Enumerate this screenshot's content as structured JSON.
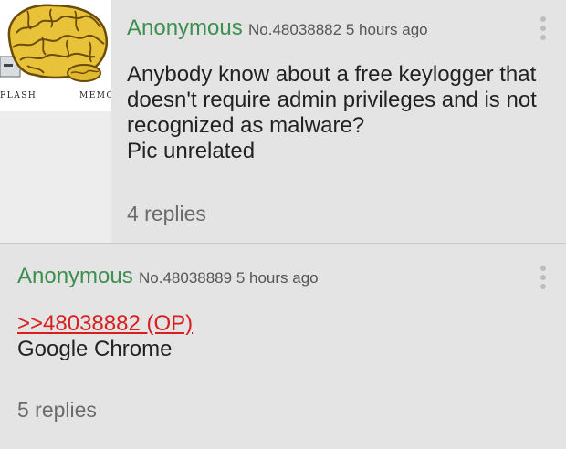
{
  "posts": [
    {
      "name": "Anonymous",
      "number": "No.48038882",
      "time": "5 hours ago",
      "body": [
        "Anybody know about a free keylogger that",
        "doesn't require admin privileges and is not",
        "recognized as malware?",
        "Pic unrelated"
      ],
      "replies": "4 replies",
      "image_label_left": "FLASH",
      "image_label_right": "MEMORY"
    },
    {
      "name": "Anonymous",
      "number": "No.48038889",
      "time": "5 hours ago",
      "quote": ">>48038882 (OP)",
      "body": [
        "Google Chrome"
      ],
      "replies": "5 replies"
    }
  ],
  "colors": {
    "name": "#3e8e4f",
    "quote_link": "#d81e1e",
    "background": "#e4e4e4"
  },
  "icons": [
    "kebab-menu-icon",
    "brain-flash-memory-image"
  ]
}
